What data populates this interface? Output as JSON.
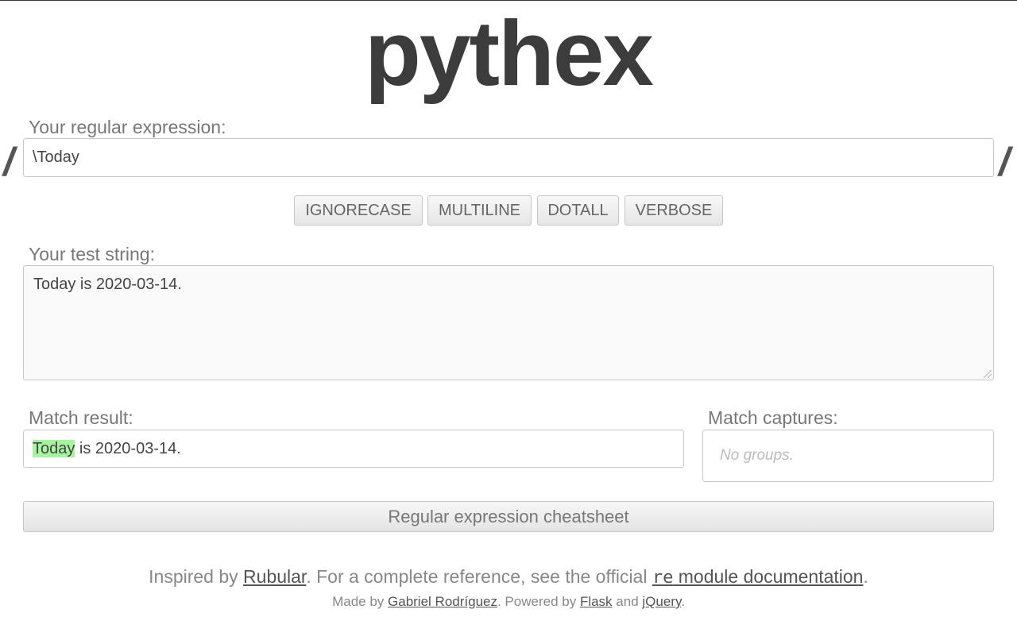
{
  "app": {
    "title": "pythex"
  },
  "regex": {
    "label": "Your regular expression:",
    "delimiter": "/",
    "value": "\\Today"
  },
  "flags": [
    "IGNORECASE",
    "MULTILINE",
    "DOTALL",
    "VERBOSE"
  ],
  "test": {
    "label": "Your test string:",
    "value": "Today is 2020-03-14."
  },
  "result": {
    "label": "Match result:",
    "match_text": "Today",
    "rest_text": " is 2020-03-14.",
    "highlight_color": "#a4f59e"
  },
  "captures": {
    "label": "Match captures:",
    "placeholder": "No groups."
  },
  "cheatsheet": {
    "label": "Regular expression cheatsheet"
  },
  "footer": {
    "inspired_prefix": "Inspired by ",
    "rubular_link": "Rubular",
    "inspired_middle": ". For a complete reference, see the official ",
    "re_module": "re",
    "docs_link": " module documentation",
    "inspired_suffix": ".",
    "made_prefix": "Made by ",
    "author_link": "Gabriel Rodríguez",
    "powered": ". Powered by ",
    "flask_link": "Flask",
    "and": " and ",
    "jquery_link": "jQuery",
    "made_suffix": "."
  }
}
